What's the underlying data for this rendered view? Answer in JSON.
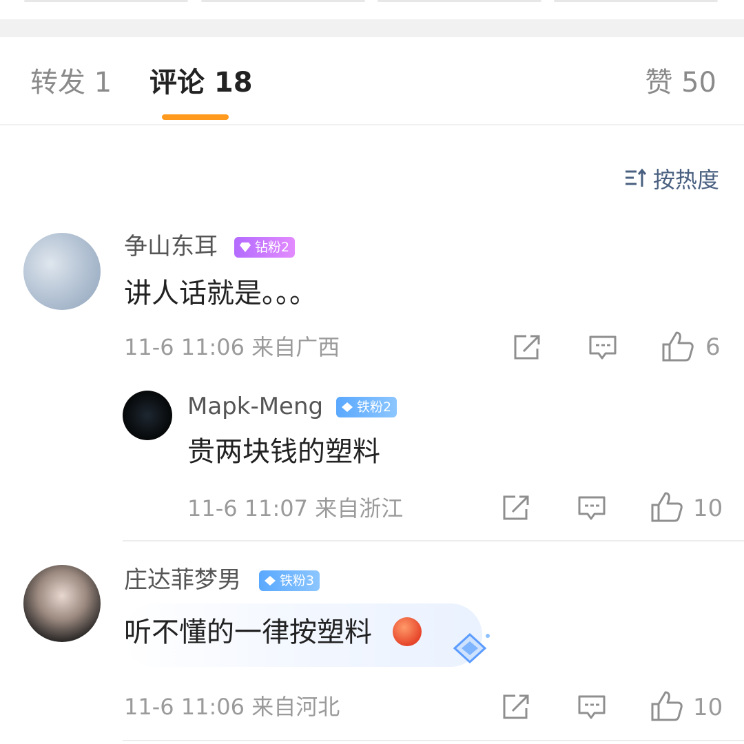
{
  "tabs": [
    {
      "label": "转发 1"
    },
    {
      "label": "评论 18"
    },
    {
      "label": "赞 50"
    }
  ],
  "sort": {
    "label": "按热度"
  },
  "comments": [
    {
      "username": "争山东耳",
      "badge": "钻粉2",
      "text": "讲人话就是。。。",
      "meta": "11-6 11:06 来自广西",
      "likes": "6"
    },
    {
      "username": "Mapk-Meng",
      "badge": "铁粉2",
      "text": "贵两块钱的塑料",
      "meta": "11-6 11:07 来自浙江",
      "likes": "10"
    },
    {
      "username": "庄达菲梦男",
      "badge": "铁粉3",
      "text": "听不懂的一律按塑料",
      "meta": "11-6 11:06 来自河北",
      "likes": "10"
    }
  ],
  "colors": {
    "accent": "#ff9a1f",
    "sort": "#4a6080",
    "badge_diamond": "#b36bff",
    "badge_iron": "#5aa8ff"
  },
  "icons": [
    "sort-icon",
    "share-icon",
    "comment-icon",
    "like-icon",
    "angry-emoji-icon",
    "diamond-gem-icon"
  ]
}
